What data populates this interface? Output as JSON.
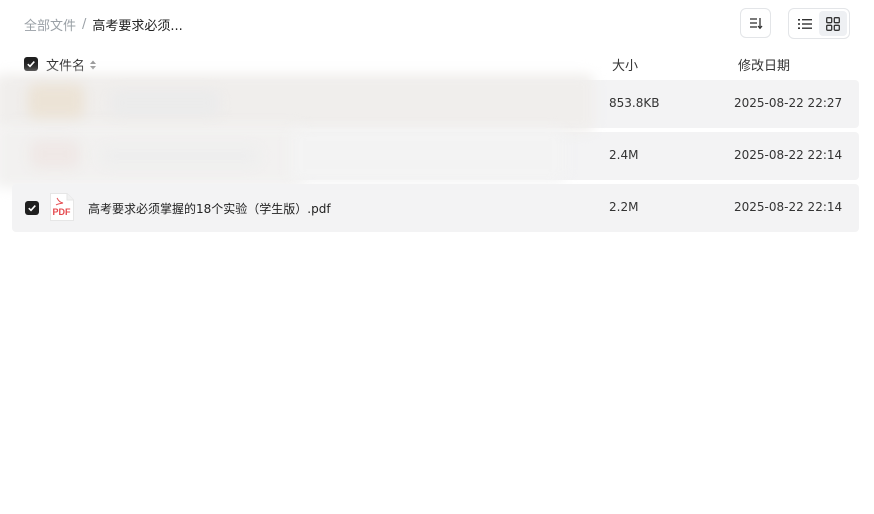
{
  "breadcrumb": {
    "root": "全部文件",
    "separator": "/",
    "current": "高考要求必须..."
  },
  "toolbar": {
    "sort_icon": "sort-icon",
    "list_view_icon": "list-view-icon",
    "grid_view_icon": "grid-view-icon",
    "active_view": "list"
  },
  "table": {
    "headers": {
      "name": "文件名",
      "size": "大小",
      "modified": "修改日期"
    },
    "rows": [
      {
        "name": "",
        "size": "853.8KB",
        "modified": "2025-08-22 22:27",
        "checked": false,
        "redacted": true
      },
      {
        "name": "",
        "size": "2.4M",
        "modified": "2025-08-22 22:14",
        "checked": false,
        "redacted": true
      },
      {
        "name": "高考要求必须掌握的18个实验（学生版）.pdf",
        "size": "2.2M",
        "modified": "2025-08-22 22:14",
        "checked": true,
        "icon": "pdf-file-icon",
        "icon_label": "PDF"
      }
    ]
  },
  "colors": {
    "row_bg": "#f3f3f4",
    "checkbox": "#1f1f1f",
    "pdf_red": "#e5484d"
  }
}
